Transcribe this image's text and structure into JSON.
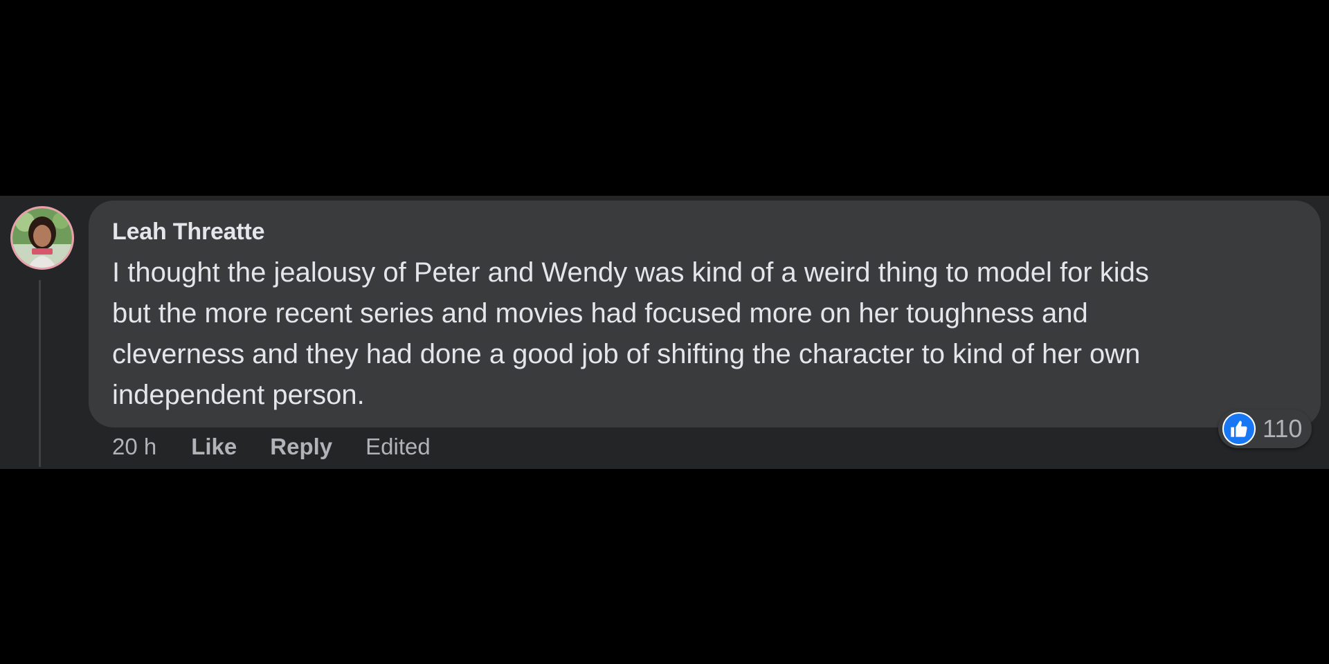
{
  "comment": {
    "author": "Leah Threatte",
    "body_lines": [
      "I thought the jealousy of Peter and Wendy was kind of a weird thing to model for kids",
      "but the more recent series and movies had focused more on her toughness and",
      "cleverness and they had done a good job of shifting the character to kind of her own",
      "independent person."
    ],
    "timestamp": "20 h",
    "actions": {
      "like_label": "Like",
      "reply_label": "Reply",
      "edited_label": "Edited"
    },
    "reactions": {
      "icon": "thumbs-up-icon",
      "count": "110",
      "color": "#1877f2"
    }
  },
  "colors": {
    "page_background": "#000000",
    "strip_background": "#242526",
    "bubble_background": "#3a3b3c",
    "primary_text": "#e4e6eb",
    "secondary_text": "#b0b3b8",
    "like_blue": "#1877f2"
  }
}
